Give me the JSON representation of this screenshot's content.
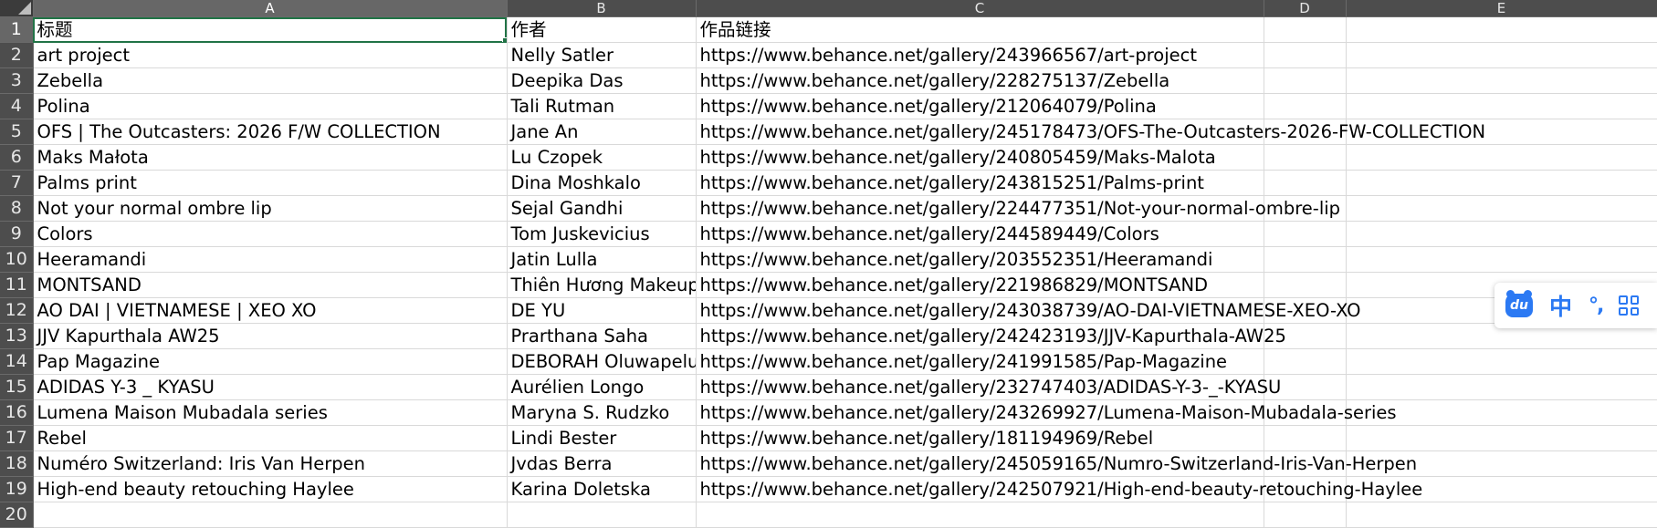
{
  "spreadsheet": {
    "column_headers": [
      "A",
      "B",
      "C",
      "D",
      "E"
    ],
    "row_numbers": [
      "1",
      "2",
      "3",
      "4",
      "5",
      "6",
      "7",
      "8",
      "9",
      "10",
      "11",
      "12",
      "13",
      "14",
      "15",
      "16",
      "17",
      "18",
      "19",
      "20"
    ],
    "selected_cell": "A1",
    "rows": [
      [
        "标题",
        "作者",
        "作品链接"
      ],
      [
        "art project",
        "Nelly Satler",
        "https://www.behance.net/gallery/243966567/art-project"
      ],
      [
        "Zebella",
        "Deepika Das",
        "https://www.behance.net/gallery/228275137/Zebella"
      ],
      [
        "Polina",
        "Tali Rutman",
        "https://www.behance.net/gallery/212064079/Polina"
      ],
      [
        "OFS | The Outcasters: 2026 F/W COLLECTION",
        "Jane An",
        "https://www.behance.net/gallery/245178473/OFS-The-Outcasters-2026-FW-COLLECTION"
      ],
      [
        "Maks Małota",
        "Lu Czopek",
        "https://www.behance.net/gallery/240805459/Maks-Malota"
      ],
      [
        "Palms print",
        "Dina Moshkalo",
        "https://www.behance.net/gallery/243815251/Palms-print"
      ],
      [
        "Not your normal ombre lip",
        "Sejal Gandhi",
        "https://www.behance.net/gallery/224477351/Not-your-normal-ombre-lip"
      ],
      [
        "Colors",
        "Tom Juskevicius",
        "https://www.behance.net/gallery/244589449/Colors"
      ],
      [
        "Heeramandi",
        "Jatin Lulla",
        "https://www.behance.net/gallery/203552351/Heeramandi"
      ],
      [
        "MONTSAND",
        "Thiên Hương Makeup",
        "https://www.behance.net/gallery/221986829/MONTSAND"
      ],
      [
        "AO DAI | VIETNAMESE | XEO XO",
        "DE YU",
        "https://www.behance.net/gallery/243038739/AO-DAI-VIETNAMESE-XEO-XO"
      ],
      [
        "JJV Kapurthala AW25",
        "Prarthana Saha",
        "https://www.behance.net/gallery/242423193/JJV-Kapurthala-AW25"
      ],
      [
        "Pap Magazine",
        "DEBORAH Oluwapelumi",
        "https://www.behance.net/gallery/241991585/Pap-Magazine"
      ],
      [
        "ADIDAS Y-3 _ KYASU",
        "Aurélien Longo",
        "https://www.behance.net/gallery/232747403/ADIDAS-Y-3-_-KYASU"
      ],
      [
        "Lumena Maison Mubadala series",
        "Maryna S. Rudzko",
        "https://www.behance.net/gallery/243269927/Lumena-Maison-Mubadala-series"
      ],
      [
        "Rebel",
        "Lindi Bester",
        "https://www.behance.net/gallery/181194969/Rebel"
      ],
      [
        "Numéro Switzerland: Iris Van Herpen",
        "Jvdas Berra",
        "https://www.behance.net/gallery/245059165/Numro-Switzerland-Iris-Van-Herpen"
      ],
      [
        "High-end beauty retouching Haylee",
        "Karina Doletska",
        "https://www.behance.net/gallery/242507921/High-end-beauty-retouching-Haylee"
      ],
      [
        "",
        "",
        ""
      ]
    ]
  },
  "ime_toolbar": {
    "logo_text": "du",
    "mode_label": "中",
    "punct_label": "°,",
    "icons": [
      "baidu-input-logo-icon",
      "chinese-mode-icon",
      "punctuation-icon",
      "grid-menu-icon"
    ],
    "accent_color": "#2b79f3"
  },
  "colors": {
    "header_bg": "#4d4d4d",
    "active_header_bg": "#676767",
    "selection_border": "#217346",
    "gridline": "#d9d9d9"
  }
}
